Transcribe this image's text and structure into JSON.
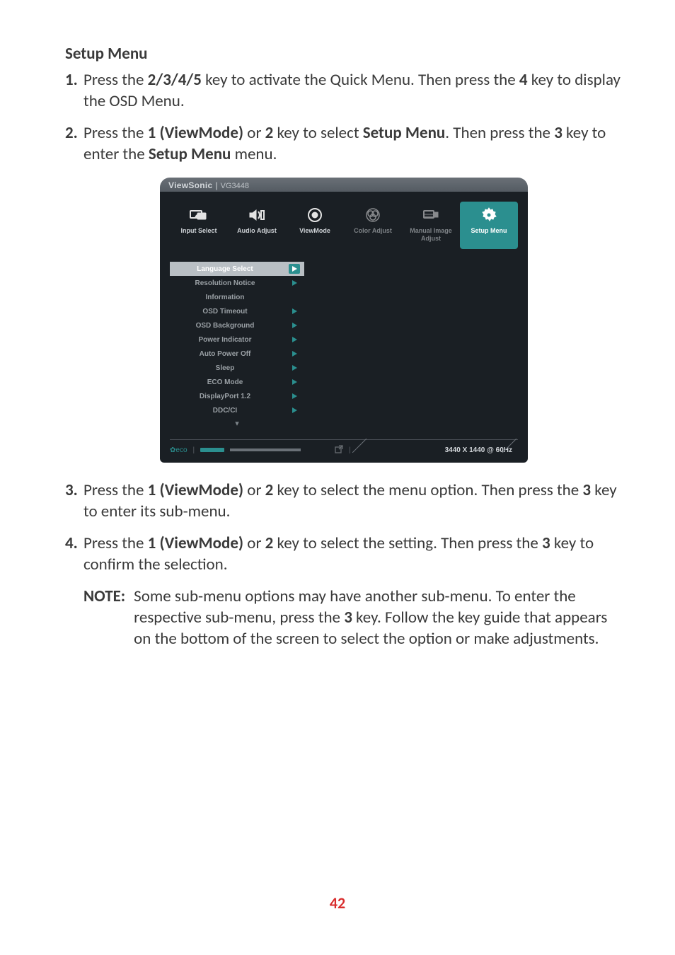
{
  "heading": "Setup Menu",
  "steps": {
    "s1": {
      "t1": "Press the ",
      "b1": "2/3/4/5",
      "t2": " key to activate the Quick Menu. Then press the ",
      "b2": "4",
      "t3": " key to display the OSD Menu."
    },
    "s2": {
      "t1": "Press the ",
      "b1": "1 (ViewMode)",
      "t2": " or ",
      "b2": "2",
      "t3": " key to select ",
      "b3": "Setup Menu",
      "t4": ". Then press the ",
      "b4": "3",
      "t5": " key to enter the ",
      "b5": "Setup Menu",
      "t6": " menu."
    },
    "s3": {
      "t1": "Press the ",
      "b1": "1 (ViewMode)",
      "t2": " or ",
      "b2": "2",
      "t3": " key to select the menu option. Then press the ",
      "b3": "3",
      "t4": " key to enter its sub-menu."
    },
    "s4": {
      "t1": "Press the ",
      "b1": "1 (ViewMode)",
      "t2": " or ",
      "b2": "2",
      "t3": " key to select the setting. Then press the ",
      "b3": "3",
      "t4": " key to confirm the selection."
    }
  },
  "note": {
    "label": "NOTE:",
    "body_t1": "Some sub-menu options may have another sub-menu. To enter the respective sub-menu, press the ",
    "body_b1": "3",
    "body_t2": " key. Follow the key guide that appears on the bottom of the screen to select the option or make adjustments."
  },
  "osd": {
    "brand": "ViewSonic",
    "model": "VG3448",
    "tabs": {
      "input": "Input Select",
      "audio": "Audio Adjust",
      "viewmode": "ViewMode",
      "color": "Color Adjust",
      "manual": "Manual Image Adjust",
      "setup": "Setup Menu"
    },
    "menu": [
      {
        "label": "Language Select",
        "arrow": true
      },
      {
        "label": "Resolution Notice",
        "arrow": true
      },
      {
        "label": "Information",
        "arrow": false
      },
      {
        "label": "OSD Timeout",
        "arrow": true
      },
      {
        "label": "OSD Background",
        "arrow": true
      },
      {
        "label": "Power Indicator",
        "arrow": true
      },
      {
        "label": "Auto Power Off",
        "arrow": true
      },
      {
        "label": "Sleep",
        "arrow": true
      },
      {
        "label": "ECO Mode",
        "arrow": true
      },
      {
        "label": "DisplayPort 1.2",
        "arrow": true
      },
      {
        "label": "DDC/CI",
        "arrow": true
      }
    ],
    "resolution": "3440 X 1440 @ 60Hz"
  },
  "page_number": "42"
}
